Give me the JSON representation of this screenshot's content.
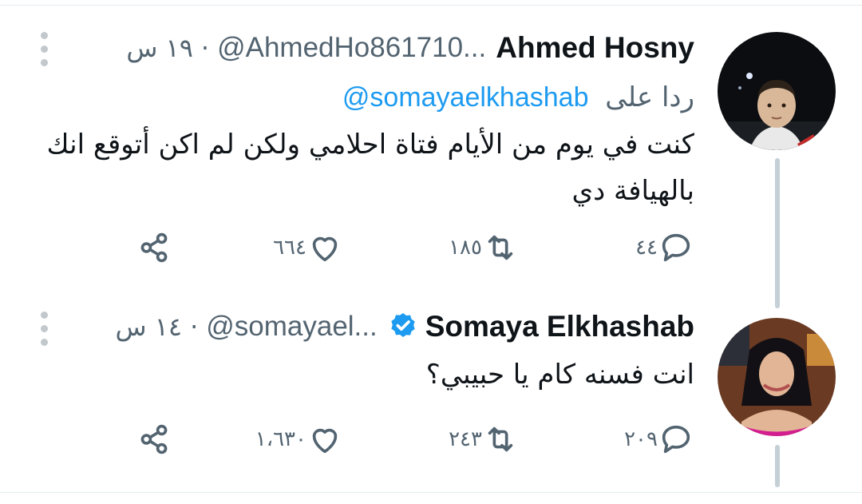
{
  "tweets": [
    {
      "name": "Ahmed Hosny",
      "handle": "@AhmedHo861710...",
      "separator": "·",
      "time": "١٩ س",
      "verified": false,
      "reply_prefix": "ردا على",
      "reply_to": "@somayaelkhashab",
      "text": "كنت في يوم من الأيام فتاة احلامي ولكن لم اكن أتوقع انك بالهيافة دي",
      "replies": "٤٤",
      "retweets": "١٨٥",
      "likes": "٦٦٤"
    },
    {
      "name": "Somaya Elkhashab",
      "handle": "@somayael...",
      "separator": "·",
      "time": "١٤ س",
      "verified": true,
      "text": "انت فسنه كام يا حبيبي؟",
      "replies": "٢٠٩",
      "retweets": "٢٤٣",
      "likes": "١،٦٣٠"
    }
  ],
  "icons": {
    "reply": "comment-bubble-icon",
    "retweet": "retweet-icon",
    "like": "heart-icon",
    "share": "share-icon",
    "more": "more-vertical-icon",
    "verified": "verified-badge-icon"
  },
  "colors": {
    "accent": "#1d9bf0",
    "secondary_text": "#536471",
    "primary_text": "#0f1419",
    "thread_line": "#c4cfd6"
  }
}
